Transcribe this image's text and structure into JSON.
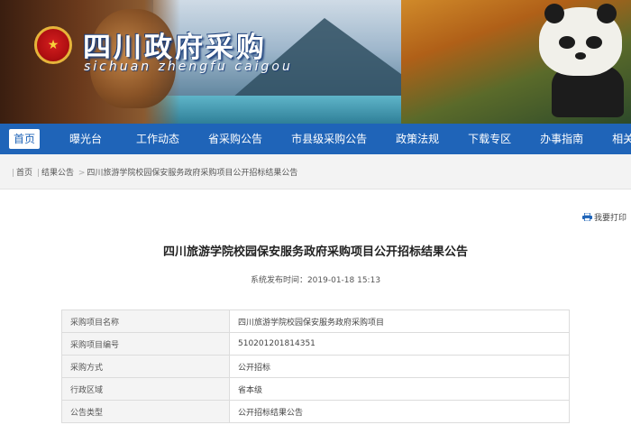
{
  "header": {
    "title": "四川政府采购",
    "subtitle": "sichuan zhengfu caigou"
  },
  "nav": {
    "items": [
      "首页",
      "曝光台",
      "工作动态",
      "省采购公告",
      "市县级采购公告",
      "政策法规",
      "下载专区",
      "办事指南",
      "相关模块"
    ],
    "active_index": 0
  },
  "breadcrumb": {
    "items": [
      "首页",
      "结果公告",
      "四川旅游学院校园保安服务政府采购项目公开招标结果公告"
    ]
  },
  "toolbar": {
    "print_label": "我要打印"
  },
  "article": {
    "title": "四川旅游学院校园保安服务政府采购项目公开招标结果公告",
    "publish_time": "系统发布时间：2019-01-18 15:13"
  },
  "info_table": {
    "rows": [
      {
        "label": "采购项目名称",
        "value": "四川旅游学院校园保安服务政府采购项目"
      },
      {
        "label": "采购项目编号",
        "value": "510201201814351"
      },
      {
        "label": "采购方式",
        "value": "公开招标"
      },
      {
        "label": "行政区域",
        "value": "省本级"
      },
      {
        "label": "公告类型",
        "value": "公开招标结果公告"
      }
    ]
  },
  "colors": {
    "nav_bg": "#1f64b8",
    "emblem_red": "#b10f12"
  }
}
